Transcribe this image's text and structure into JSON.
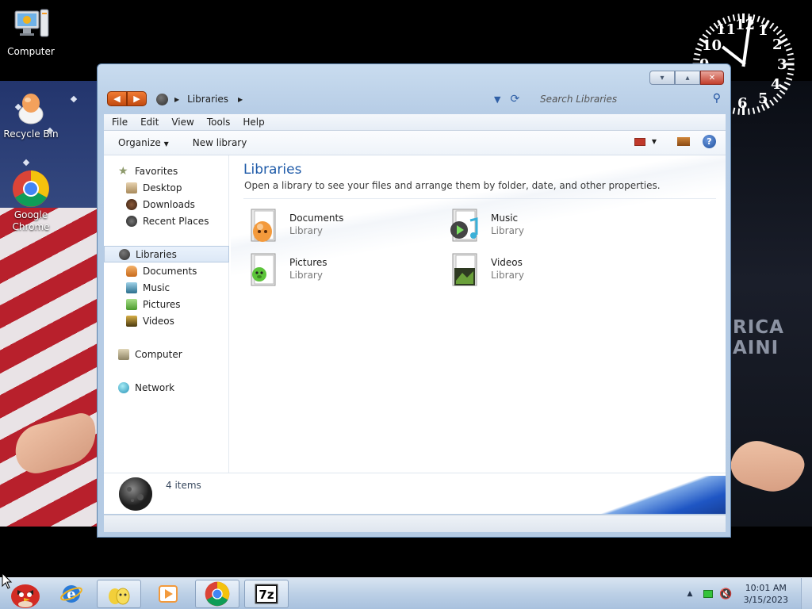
{
  "desktop": {
    "icons": [
      {
        "label": "Computer",
        "icon": "computer-icon"
      },
      {
        "label": "Recycle Bin",
        "icon": "recycle-bin-icon"
      },
      {
        "label": "Google Chrome",
        "icon": "chrome-icon"
      }
    ],
    "background_text": [
      "RICA",
      "AINI"
    ],
    "clock_numbers": [
      "11",
      "12",
      "1",
      "2",
      "3",
      "4",
      "5",
      "6",
      "10",
      "9"
    ]
  },
  "window": {
    "address": {
      "crumbs": [
        "Libraries"
      ]
    },
    "search": {
      "placeholder": "Search Libraries"
    },
    "menu": [
      "File",
      "Edit",
      "View",
      "Tools",
      "Help"
    ],
    "commands": {
      "organize": "Organize",
      "new_library": "New library"
    },
    "nav": {
      "favorites": {
        "label": "Favorites",
        "items": [
          "Desktop",
          "Downloads",
          "Recent Places"
        ]
      },
      "libraries": {
        "label": "Libraries",
        "items": [
          "Documents",
          "Music",
          "Pictures",
          "Videos"
        ]
      },
      "computer": "Computer",
      "network": "Network"
    },
    "main": {
      "title": "Libraries",
      "subtitle": "Open a library to see your files and arrange them by folder, date, and other properties.",
      "libraries": [
        {
          "name": "Documents",
          "type": "Library"
        },
        {
          "name": "Music",
          "type": "Library"
        },
        {
          "name": "Pictures",
          "type": "Library"
        },
        {
          "name": "Videos",
          "type": "Library"
        }
      ]
    },
    "details": {
      "count": "4 items"
    }
  },
  "taskbar": {
    "apps": [
      "angry-birds-start-icon",
      "internet-explorer-icon",
      "explorer-folder-icon",
      "media-player-icon",
      "chrome-icon",
      "7zip-icon"
    ],
    "tray": {
      "time": "10:01 AM",
      "date": "3/15/2023"
    }
  },
  "colors": {
    "accent": "#1e5aa8",
    "nav_orange": "#e0621f",
    "close_red": "#c33e2b"
  }
}
